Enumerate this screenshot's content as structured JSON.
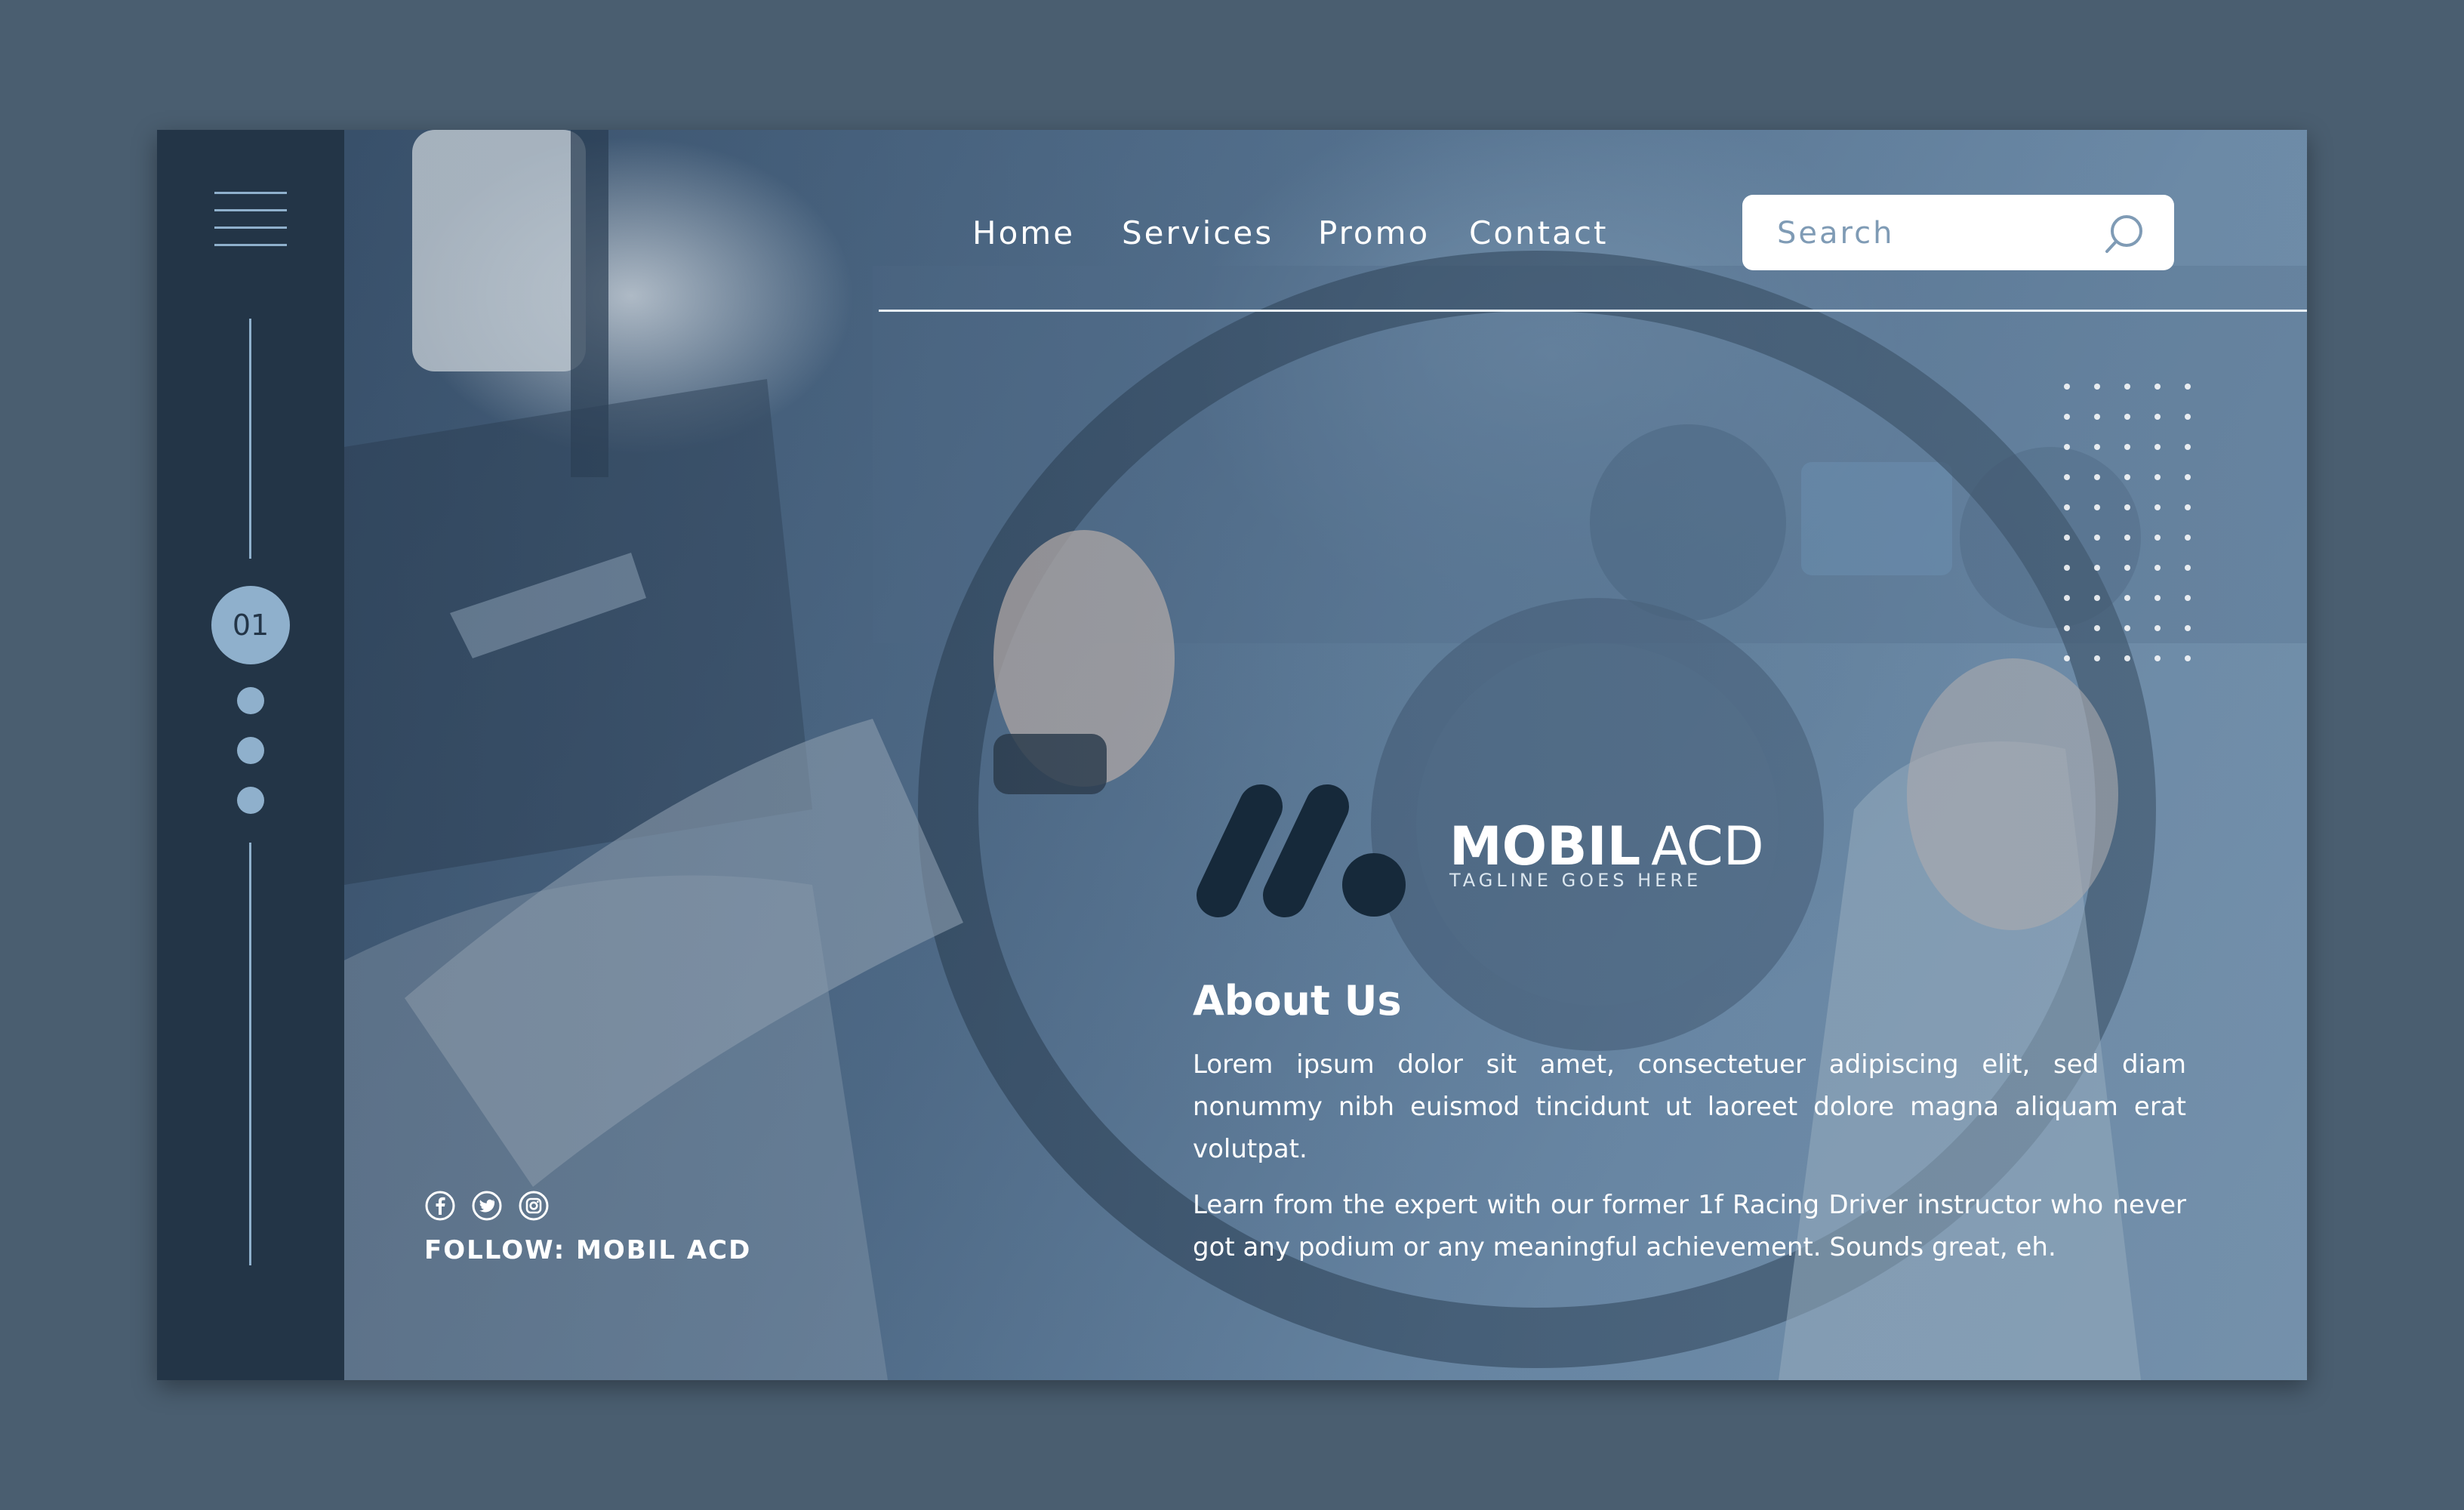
{
  "nav": {
    "items": [
      {
        "label": "Home"
      },
      {
        "label": "Services"
      },
      {
        "label": "Promo"
      },
      {
        "label": "Contact"
      }
    ]
  },
  "search": {
    "placeholder": "Search",
    "icon": "search-icon"
  },
  "sidebar": {
    "menu_icon": "hamburger-menu-icon",
    "page_number": "01",
    "pager_dots": 3
  },
  "brand": {
    "name_bold": "MOBIL",
    "name_light": "ACD",
    "tagline": "TAGLINE GOES HERE"
  },
  "about": {
    "title": "About Us",
    "paragraph_1": "Lorem ipsum dolor sit amet, consectetuer adipiscing elit, sed diam nonummy nibh euismod tincidunt ut laoreet dolore magna aliquam erat volutpat.",
    "paragraph_2": "Learn from the expert with our former 1f Racing Driver instructor who never got any podium or any meaningful achievement. Sounds great, eh."
  },
  "social": {
    "icons": [
      "facebook-icon",
      "twitter-icon",
      "instagram-icon"
    ],
    "follow_text": "FOLLOW: MOBIL ACD"
  },
  "colors": {
    "page_bg": "#4a5e70",
    "sidebar_bg": "#233547",
    "accent": "#8fb0cc",
    "logo_dark": "#16293a",
    "text_light": "#ffffff"
  }
}
